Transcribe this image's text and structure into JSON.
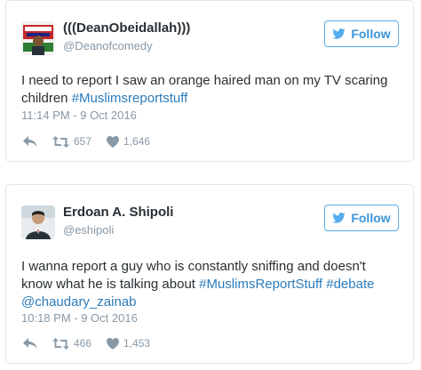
{
  "tweets": [
    {
      "display_name": "(((DeanObeidallah)))",
      "handle": "@Deanofcomedy",
      "follow_label": "Follow",
      "text_plain": "I need to report I saw an orange haired man on my TV scaring children ",
      "hashtag": "#Muslimsreportstuff",
      "timestamp": "11:14 PM - 9 Oct 2016",
      "retweets": "657",
      "likes": "1,646"
    },
    {
      "display_name": "Erdoan A. Shipoli",
      "handle": "@eshipoli",
      "follow_label": "Follow",
      "text_plain": "I wanna report a guy who is constantly sniffing and doesn't know what he is talking about ",
      "hashtag": "#MuslimsReportStuff",
      "hashtag2": "#debate",
      "mention": "@chaudary_zainab",
      "timestamp": "10:18 PM - 9 Oct 2016",
      "retweets": "466",
      "likes": "1,453"
    }
  ],
  "icons": {
    "reply": "reply-icon",
    "retweet": "retweet-icon",
    "like": "heart-icon",
    "follow": "twitter-bird-icon"
  },
  "colors": {
    "link": "#2b7bb9",
    "follow_border": "#55acee",
    "meta": "#8899a6",
    "text": "#292f33"
  }
}
